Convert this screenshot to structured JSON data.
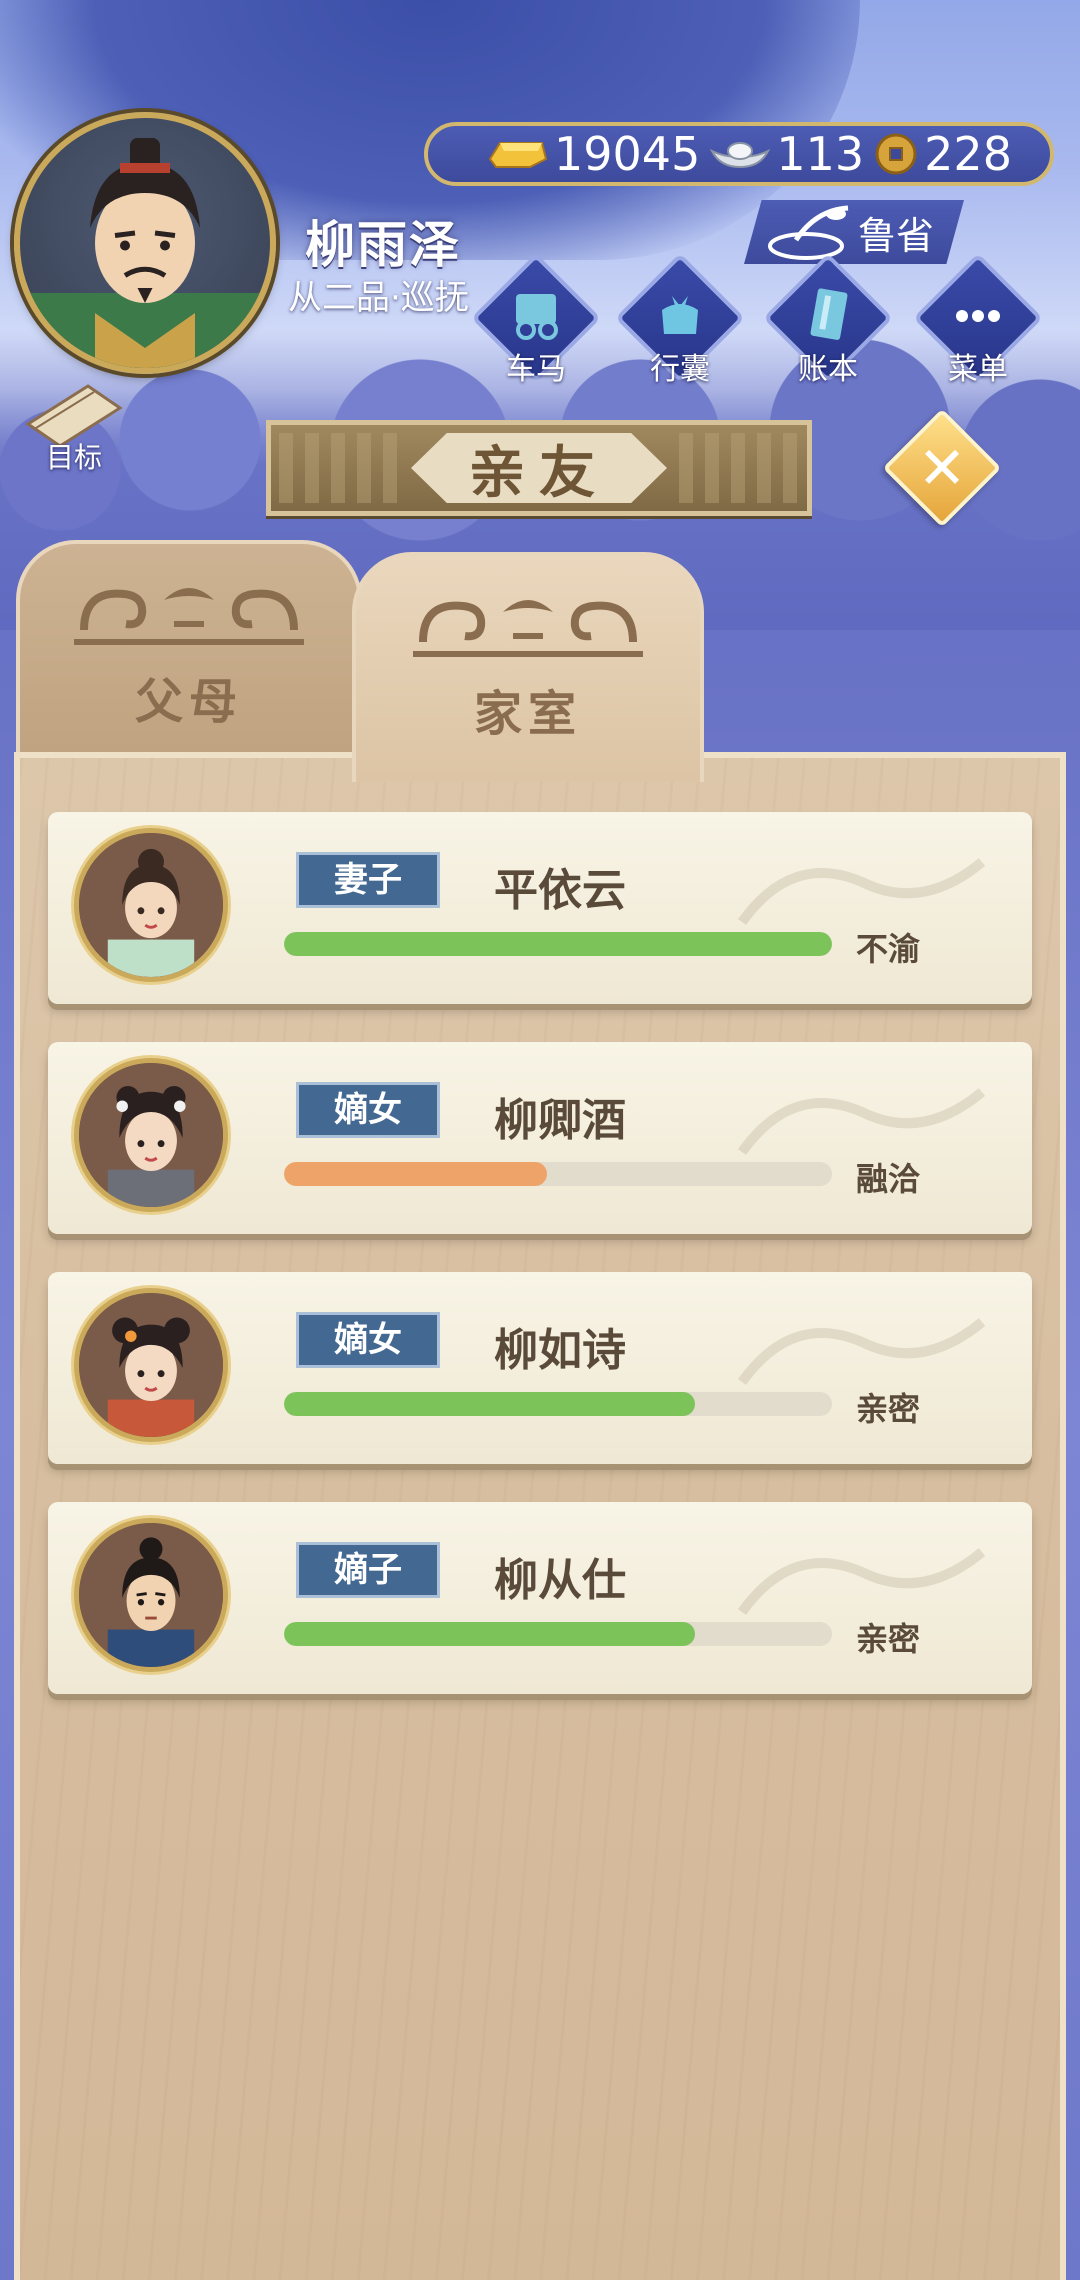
{
  "player": {
    "name": "柳雨泽",
    "rank": "从二品·巡抚",
    "avatar_icon": "official-portrait"
  },
  "currency": {
    "gold": "19045",
    "silver": "113",
    "coins": "228"
  },
  "region": {
    "label": "鲁省",
    "icon": "inkstone-brush-icon"
  },
  "menu": [
    {
      "label": "车马",
      "icon": "carriage-icon"
    },
    {
      "label": "行囊",
      "icon": "bundle-icon"
    },
    {
      "label": "账本",
      "icon": "ledger-icon"
    },
    {
      "label": "菜单",
      "icon": "more-icon"
    }
  ],
  "target": {
    "label": "目标",
    "icon": "scroll-icon"
  },
  "title": "亲友",
  "tabs": [
    {
      "label": "父母",
      "active": false
    },
    {
      "label": "家室",
      "active": true
    }
  ],
  "members": [
    {
      "relation": "妻子",
      "name": "平依云",
      "status": "不渝",
      "affection": 1.0,
      "bar_color": "#7cc45a"
    },
    {
      "relation": "嫡女",
      "name": "柳卿酒",
      "status": "融洽",
      "affection": 0.48,
      "bar_color": "#eea468"
    },
    {
      "relation": "嫡女",
      "name": "柳如诗",
      "status": "亲密",
      "affection": 0.75,
      "bar_color": "#7cc45a"
    },
    {
      "relation": "嫡子",
      "name": "柳从仕",
      "status": "亲密",
      "affection": 0.75,
      "bar_color": "#7cc45a"
    }
  ],
  "colors": {
    "accent_gold": "#caa95a",
    "relation_badge": "#436993",
    "progress_green": "#7cc45a",
    "progress_orange": "#eea468"
  }
}
